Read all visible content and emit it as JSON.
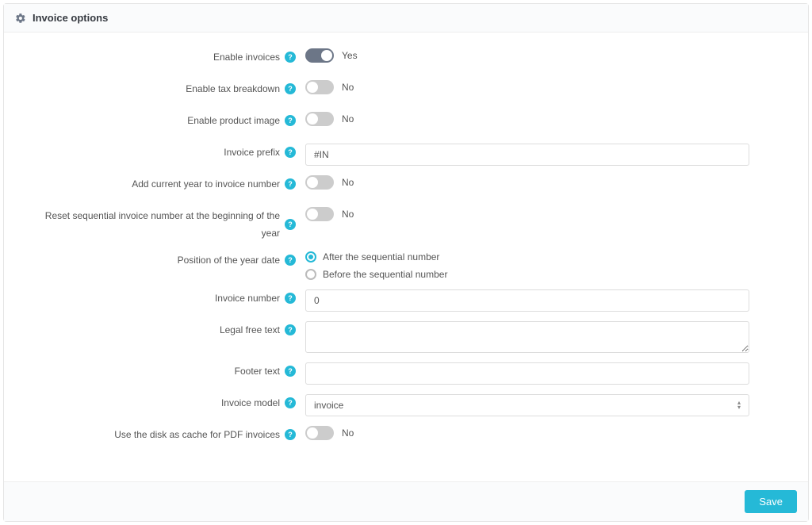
{
  "header": {
    "title": "Invoice options"
  },
  "fields": {
    "enable_invoices": {
      "label": "Enable invoices",
      "value_text": "Yes",
      "on": true
    },
    "enable_tax": {
      "label": "Enable tax breakdown",
      "value_text": "No",
      "on": false
    },
    "enable_product_image": {
      "label": "Enable product image",
      "value_text": "No",
      "on": false
    },
    "invoice_prefix": {
      "label": "Invoice prefix",
      "value": "#IN"
    },
    "add_year": {
      "label": "Add current year to invoice number",
      "value_text": "No",
      "on": false
    },
    "reset_seq": {
      "label": "Reset sequential invoice number at the beginning of the year",
      "value_text": "No",
      "on": false
    },
    "position_year": {
      "label": "Position of the year date",
      "option_after": "After the sequential number",
      "option_before": "Before the sequential number",
      "selected": "after"
    },
    "invoice_number": {
      "label": "Invoice number",
      "value": "0"
    },
    "legal_free_text": {
      "label": "Legal free text",
      "value": ""
    },
    "footer_text": {
      "label": "Footer text",
      "value": ""
    },
    "invoice_model": {
      "label": "Invoice model",
      "value": "invoice"
    },
    "disk_cache": {
      "label": "Use the disk as cache for PDF invoices",
      "value_text": "No",
      "on": false
    }
  },
  "footer": {
    "save": "Save"
  },
  "info_glyph": "?"
}
